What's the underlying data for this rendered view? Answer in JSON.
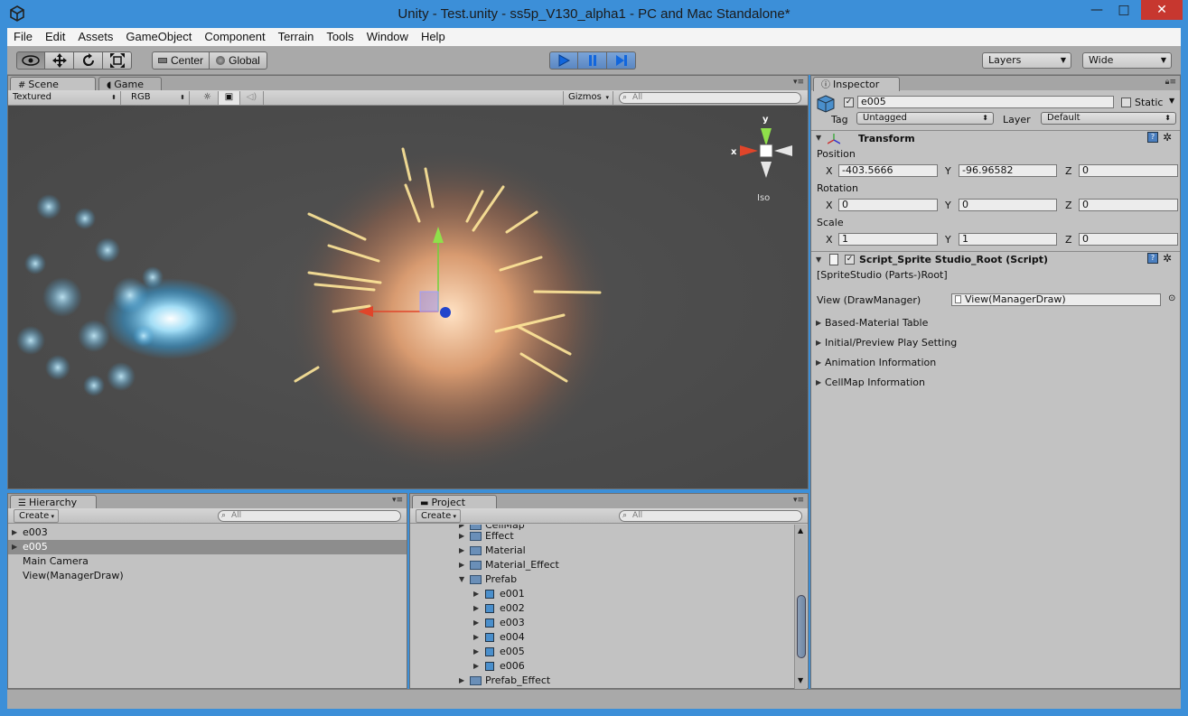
{
  "window": {
    "title": "Unity - Test.unity - ss5p_V130_alpha1 - PC and Mac Standalone*",
    "minimize": "—",
    "maximize": "□",
    "close": "✕"
  },
  "menu": [
    "File",
    "Edit",
    "Assets",
    "GameObject",
    "Component",
    "Terrain",
    "Tools",
    "Window",
    "Help"
  ],
  "toolbar": {
    "pivot_center": "Center",
    "pivot_global": "Global",
    "layers": "Layers",
    "layout": "Wide",
    "icons": [
      "eye-icon",
      "move-icon",
      "rotate-icon",
      "scale-icon",
      "play-icon",
      "pause-icon",
      "step-icon"
    ]
  },
  "scene": {
    "tab_scene": "Scene",
    "tab_game": "Game",
    "render_mode": "Textured",
    "color_mode": "RGB",
    "gizmos": "Gizmos",
    "search_placeholder": "All",
    "gizmo_axis_y": "y",
    "gizmo_axis_x": "x",
    "projection": "Iso"
  },
  "hierarchy": {
    "tab": "Hierarchy",
    "create": "Create",
    "search_placeholder": "All",
    "items": [
      {
        "label": "e003",
        "foldout": true,
        "selected": false
      },
      {
        "label": "e005",
        "foldout": true,
        "selected": true
      },
      {
        "label": "Main Camera",
        "foldout": false,
        "selected": false
      },
      {
        "label": "View(ManagerDraw)",
        "foldout": false,
        "selected": false
      }
    ]
  },
  "project": {
    "tab": "Project",
    "create": "Create",
    "search_placeholder": "All",
    "partial_top": "CellMap",
    "folders": [
      {
        "label": "Effect",
        "expanded": false
      },
      {
        "label": "Material",
        "expanded": false
      },
      {
        "label": "Material_Effect",
        "expanded": false
      },
      {
        "label": "Prefab",
        "expanded": true
      }
    ],
    "prefabs": [
      "e001",
      "e002",
      "e003",
      "e004",
      "e005",
      "e006"
    ],
    "after_folder": "Prefab_Effect"
  },
  "inspector": {
    "tab": "Inspector",
    "object_name": "e005",
    "static_label": "Static",
    "tag_label": "Tag",
    "tag_value": "Untagged",
    "layer_label": "Layer",
    "layer_value": "Default",
    "transform": {
      "title": "Transform",
      "position_label": "Position",
      "rotation_label": "Rotation",
      "scale_label": "Scale",
      "axis_x": "X",
      "axis_y": "Y",
      "axis_z": "Z",
      "position": {
        "x": "-403.5666",
        "y": "-96.96582",
        "z": "0"
      },
      "rotation": {
        "x": "0",
        "y": "0",
        "z": "0"
      },
      "scale": {
        "x": "1",
        "y": "1",
        "z": "0"
      }
    },
    "script": {
      "title": "Script_Sprite Studio_Root (Script)",
      "subtitle": "[SpriteStudio (Parts-)Root]",
      "view_label": "View (DrawManager)",
      "view_value": "View(ManagerDraw)",
      "sections": [
        "Based-Material Table",
        "Initial/Preview Play Setting",
        "Animation Information",
        "CellMap Information"
      ]
    }
  }
}
